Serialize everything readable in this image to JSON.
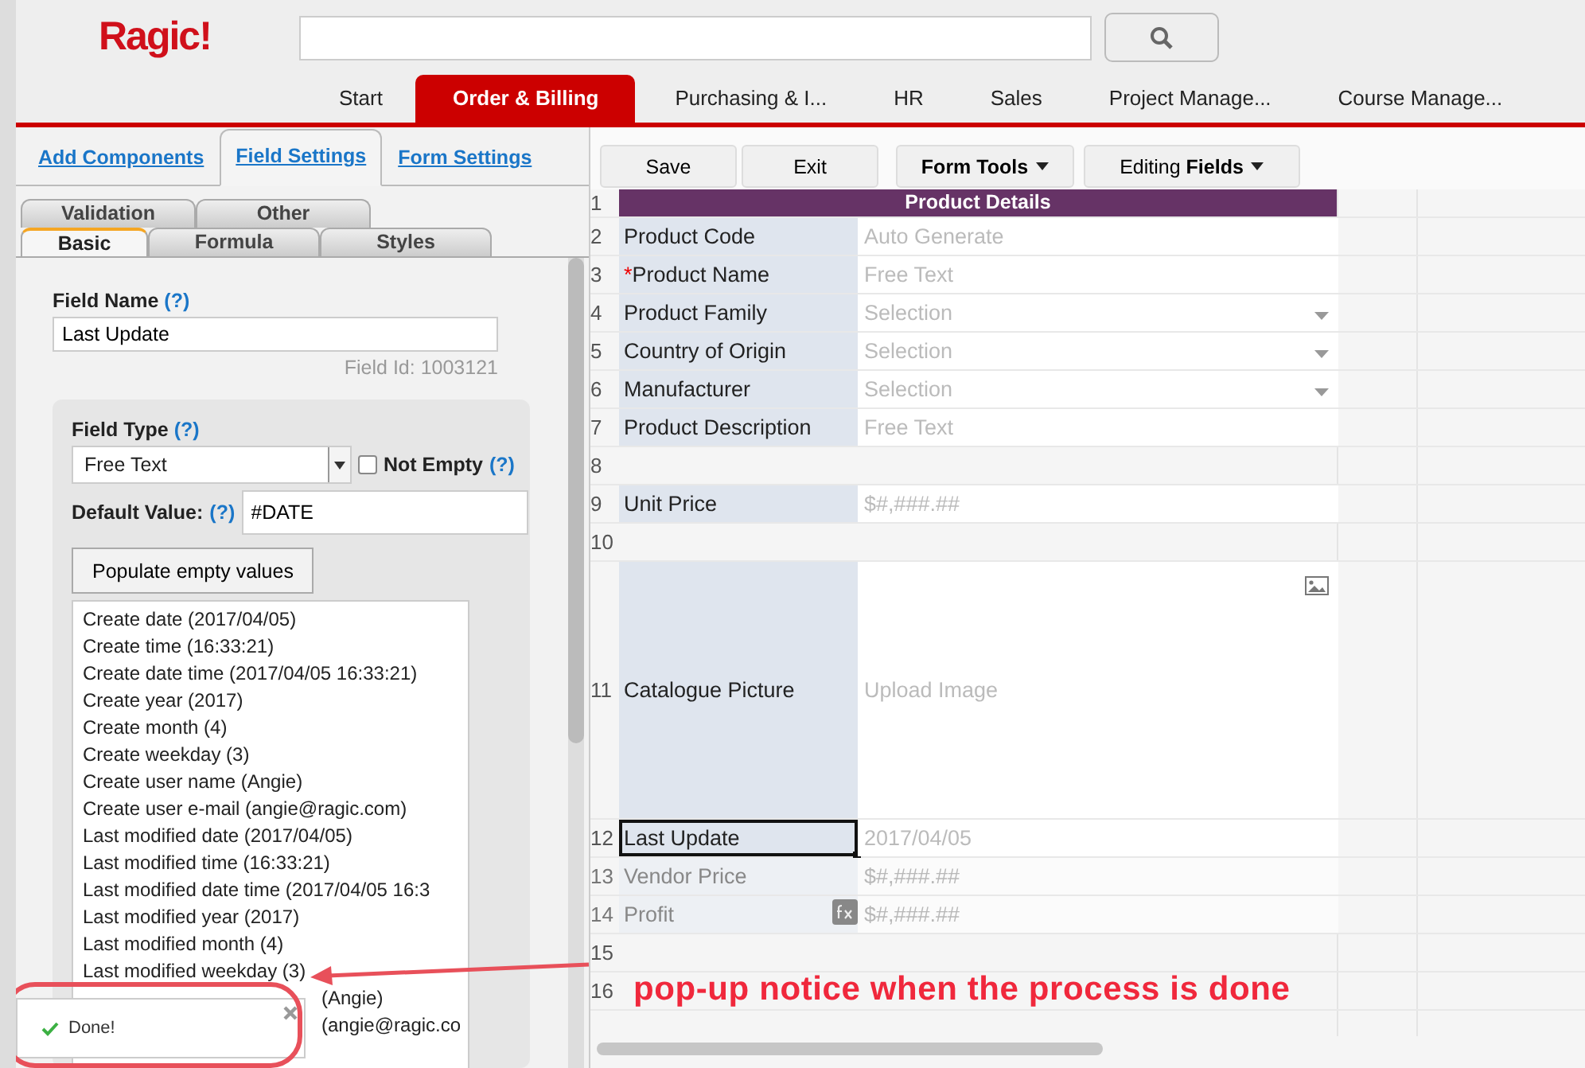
{
  "logo": "Ragic!",
  "nav_tabs": [
    {
      "label": "Start",
      "selected": false
    },
    {
      "label": "Order & Billing",
      "selected": true
    },
    {
      "label": "Purchasing & I...",
      "selected": false
    },
    {
      "label": "HR",
      "selected": false
    },
    {
      "label": "Sales",
      "selected": false
    },
    {
      "label": "Project Manage...",
      "selected": false
    },
    {
      "label": "Course Manage...",
      "selected": false
    }
  ],
  "panel_tabs": [
    {
      "label": "Add Components",
      "selected": false
    },
    {
      "label": "Field Settings",
      "selected": true
    },
    {
      "label": "Form Settings",
      "selected": false
    }
  ],
  "sub_tab_rows": [
    [
      {
        "label": "Validation",
        "selected": false
      },
      {
        "label": "Other",
        "selected": false
      }
    ],
    [
      {
        "label": "Basic",
        "selected": true
      },
      {
        "label": "Formula",
        "selected": false
      },
      {
        "label": "Styles",
        "selected": false
      }
    ]
  ],
  "field_settings": {
    "field_name_label": "Field Name",
    "field_name_help": "(?)",
    "field_name": "Last Update",
    "field_id": "Field Id: 1003121",
    "field_type_label": "Field Type",
    "field_type_help": "(?)",
    "field_type": "Free Text",
    "not_empty": {
      "label": "Not Empty",
      "help": "(?)",
      "checked": false
    },
    "default_value_label": "Default Value:",
    "default_value_help": "(?)",
    "default_value": "#DATE",
    "populate_button": "Populate empty values",
    "default_options": [
      {
        "text": "Create date (2017/04/05)",
        "kind": "full"
      },
      {
        "text": "Create time (16:33:21)",
        "kind": "full"
      },
      {
        "text": "Create date time (2017/04/05 16:33:21)",
        "kind": "full"
      },
      {
        "text": "Create year (2017)",
        "kind": "full"
      },
      {
        "text": "Create month (4)",
        "kind": "full"
      },
      {
        "text": "Create weekday (3)",
        "kind": "full"
      },
      {
        "text": "Create user name (Angie)",
        "kind": "full"
      },
      {
        "text": "Create user e-mail (angie@ragic.com)",
        "kind": "full"
      },
      {
        "text": "Last modified date (2017/04/05)",
        "kind": "full"
      },
      {
        "text": "Last modified time (16:33:21)",
        "kind": "full"
      },
      {
        "text": "Last modified date time (2017/04/05 16:3",
        "kind": "full"
      },
      {
        "text": "Last modified year (2017)",
        "kind": "full"
      },
      {
        "text": "Last modified month (4)",
        "kind": "full"
      },
      {
        "text": "Last modified weekday (3)",
        "kind": "full"
      },
      {
        "text": "(Angie)",
        "kind": "covered"
      },
      {
        "text": "(angie@ragic.co",
        "kind": "covered"
      }
    ]
  },
  "toolbar": [
    {
      "label": "Save",
      "kind": "plain"
    },
    {
      "label": "Exit",
      "kind": "plain"
    },
    {
      "label": "**Form Tools**",
      "kind": "menu"
    },
    {
      "label": "Editing **Fields**",
      "kind": "menu"
    }
  ],
  "sheet": {
    "rows": [
      {
        "num": "1",
        "kind": "header",
        "label": "Product Details",
        "selected": false,
        "disabled": false
      },
      {
        "num": "2",
        "kind": "text",
        "label": "Product Code",
        "value": "Auto Generate",
        "selected": false,
        "disabled": false
      },
      {
        "num": "3",
        "kind": "text",
        "required_mark": "*",
        "label": "Product Name",
        "value": "Free Text",
        "selected": false,
        "disabled": false
      },
      {
        "num": "4",
        "kind": "select",
        "label": "Product Family",
        "value": "Selection",
        "selected": false,
        "disabled": false
      },
      {
        "num": "5",
        "kind": "select",
        "label": "Country of Origin",
        "value": "Selection",
        "selected": false,
        "disabled": false
      },
      {
        "num": "6",
        "kind": "select",
        "label": "Manufacturer",
        "value": "Selection",
        "selected": false,
        "disabled": false
      },
      {
        "num": "7",
        "kind": "text",
        "label": "Product Description",
        "value": "Free Text",
        "selected": false,
        "disabled": false
      },
      {
        "num": "8",
        "kind": "blank",
        "selected": false,
        "disabled": false
      },
      {
        "num": "9",
        "kind": "text",
        "label": "Unit Price",
        "value": "$#,###.##",
        "selected": false,
        "disabled": false
      },
      {
        "num": "10",
        "kind": "blank",
        "selected": false,
        "disabled": false
      },
      {
        "num": "11",
        "kind": "image",
        "label": "Catalogue Picture",
        "value": "Upload Image",
        "selected": false,
        "disabled": false
      },
      {
        "num": "12",
        "kind": "text",
        "label": "Last Update",
        "value": "2017/04/05",
        "selected": true,
        "disabled": false
      },
      {
        "num": "13",
        "kind": "text",
        "label": "Vendor Price",
        "value": "$#,###.##",
        "selected": false,
        "disabled": true
      },
      {
        "num": "14",
        "kind": "formula",
        "label": "Profit",
        "value": "$#,###.##",
        "selected": false,
        "disabled": true
      },
      {
        "num": "15",
        "kind": "blank",
        "selected": false,
        "disabled": false
      },
      {
        "num": "16",
        "kind": "blank",
        "selected": false,
        "disabled": false
      }
    ]
  },
  "toast": {
    "message": "Done!"
  },
  "annotation": {
    "text": "pop-up notice when the process is done"
  }
}
